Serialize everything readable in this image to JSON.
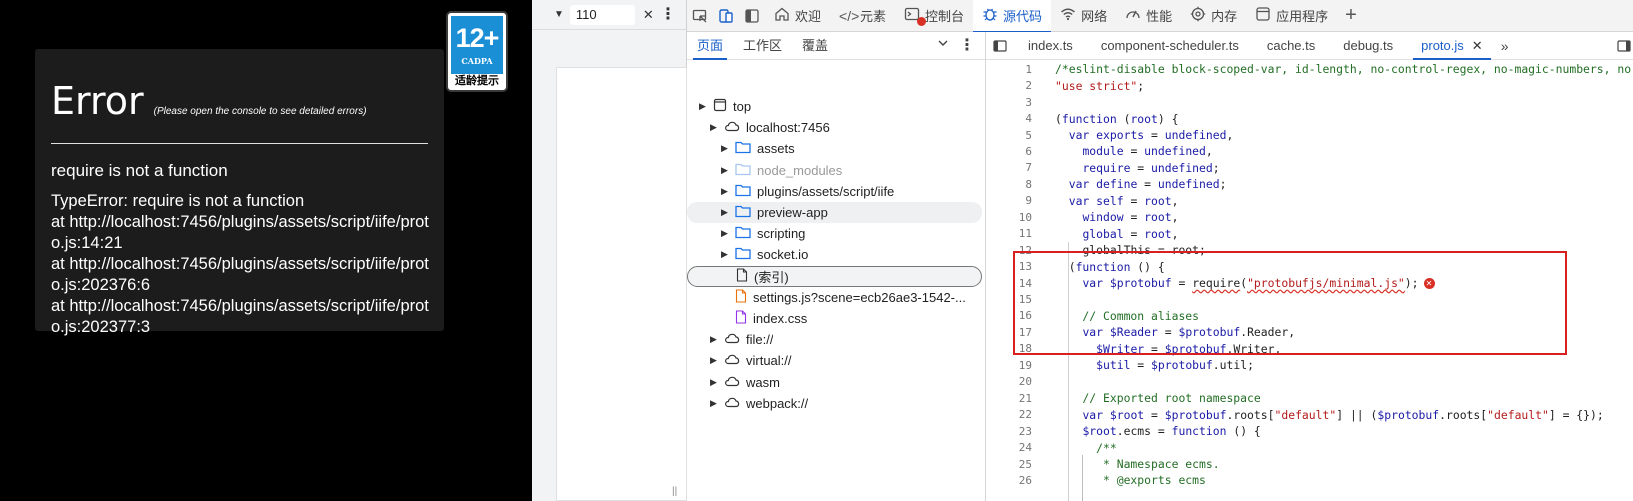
{
  "game": {
    "error_title": "Error",
    "error_hint": "(Please open the console to see detailed errors)",
    "error_message": "require is not a function",
    "stack": [
      "TypeError: require is not a function",
      "at http://localhost:7456/plugins/assets/script/iife/proto.js:14:21",
      "at http://localhost:7456/plugins/assets/script/iife/proto.js:202376:6",
      "at http://localhost:7456/plugins/assets/script/iife/proto.js:202377:3"
    ],
    "rating_badge": {
      "age": "12+",
      "org": "CADPA",
      "label": "适龄提示",
      "color": "#1a8fd6"
    }
  },
  "preview": {
    "zoom_value": "110"
  },
  "devtools": {
    "top_tabs": [
      {
        "label": "欢迎",
        "icon": "home-icon"
      },
      {
        "label": "元素",
        "icon": "code-icon"
      },
      {
        "label": "控制台",
        "icon": "console-icon"
      },
      {
        "label": "源代码",
        "icon": "bug-icon"
      },
      {
        "label": "网络",
        "icon": "wifi-icon"
      },
      {
        "label": "性能",
        "icon": "gauge-icon"
      },
      {
        "label": "内存",
        "icon": "memory-icon"
      },
      {
        "label": "应用程序",
        "icon": "application-icon"
      }
    ],
    "accent": "#1a5fc9",
    "error_color": "#d93025"
  },
  "navigator": {
    "tabs": [
      "页面",
      "工作区",
      "覆盖"
    ],
    "tree": [
      {
        "label": "top",
        "indent": 0,
        "type": "frame",
        "arrow": "▶"
      },
      {
        "label": "localhost:7456",
        "indent": 1,
        "type": "cloud",
        "arrow": "▶"
      },
      {
        "label": "assets",
        "indent": 2,
        "type": "folder",
        "arrow": "▶"
      },
      {
        "label": "node_modules",
        "indent": 2,
        "type": "folder-dim",
        "arrow": "▶"
      },
      {
        "label": "plugins/assets/script/iife",
        "indent": 2,
        "type": "folder",
        "arrow": "▶"
      },
      {
        "label": "preview-app",
        "indent": 2,
        "type": "folder",
        "arrow": "▶"
      },
      {
        "label": "scripting",
        "indent": 2,
        "type": "folder",
        "arrow": "▶"
      },
      {
        "label": "socket.io",
        "indent": 2,
        "type": "folder",
        "arrow": "▶"
      },
      {
        "label": "(索引)",
        "indent": 2,
        "type": "file",
        "arrow": ""
      },
      {
        "label": "settings.js?scene=ecb26ae3-1542-...",
        "indent": 2,
        "type": "file-js",
        "arrow": ""
      },
      {
        "label": "index.css",
        "indent": 2,
        "type": "file-css",
        "arrow": ""
      },
      {
        "label": "file://",
        "indent": 1,
        "type": "cloud",
        "arrow": "▶"
      },
      {
        "label": "virtual://",
        "indent": 1,
        "type": "cloud",
        "arrow": "▶"
      },
      {
        "label": "wasm",
        "indent": 1,
        "type": "cloud",
        "arrow": "▶"
      },
      {
        "label": "webpack://",
        "indent": 1,
        "type": "cloud",
        "arrow": "▶"
      }
    ]
  },
  "editor": {
    "file_tabs": [
      "index.ts",
      "component-scheduler.ts",
      "cache.ts",
      "debug.ts",
      "proto.js"
    ],
    "active_tab": "proto.js",
    "lines": [
      "/*eslint-disable block-scoped-var, id-length, no-control-regex, no-magic-numbers, no-pr",
      "\"use strict\";",
      "",
      "(function (root) {",
      "  var exports = undefined,",
      "    module = undefined,",
      "    require = undefined;",
      "  var define = undefined;",
      "  var self = root,",
      "    window = root,",
      "    global = root,",
      "    globalThis = root;",
      "  (function () {",
      "    var $protobuf = require(\"protobufjs/minimal.js\");",
      "",
      "    // Common aliases",
      "    var $Reader = $protobuf.Reader,",
      "      $Writer = $protobuf.Writer,",
      "      $util = $protobuf.util;",
      "",
      "    // Exported root namespace",
      "    var $root = $protobuf.roots[\"default\"] || ($protobuf.roots[\"default\"] = {});",
      "    $root.ecms = function () {",
      "      /**",
      "       * Namespace ecms.",
      "       * @exports ecms"
    ],
    "error_line": 14
  }
}
